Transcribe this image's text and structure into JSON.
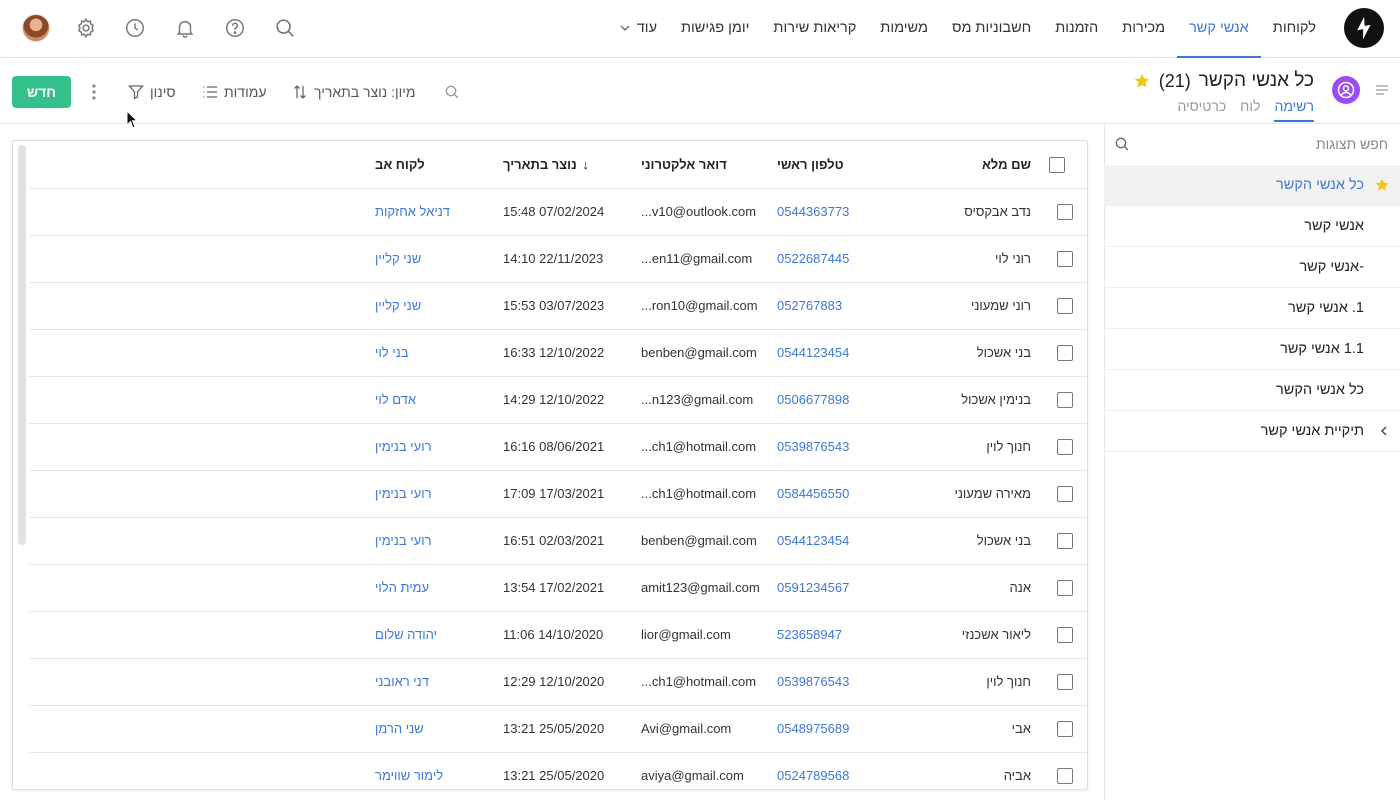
{
  "topnav": {
    "items": [
      {
        "label": "לקוחות",
        "active": false
      },
      {
        "label": "אנשי קשר",
        "active": true
      },
      {
        "label": "מכירות",
        "active": false
      },
      {
        "label": "הזמנות",
        "active": false
      },
      {
        "label": "חשבוניות מס",
        "active": false
      },
      {
        "label": "משימות",
        "active": false
      },
      {
        "label": "קריאות שירות",
        "active": false
      },
      {
        "label": "יומן פגישות",
        "active": false
      },
      {
        "label": "עוד",
        "active": false
      }
    ],
    "icons": [
      "search-icon",
      "help-icon",
      "bell-icon",
      "history-icon",
      "gear-icon",
      "user-avatar"
    ]
  },
  "header": {
    "title": "כל אנשי הקשר",
    "count": "(21)",
    "tabs": [
      {
        "label": "רשימה",
        "active": true
      },
      {
        "label": "לוח",
        "active": false
      },
      {
        "label": "כרטיסיה",
        "active": false
      }
    ]
  },
  "toolbar": {
    "new_label": "חדש",
    "filter_label": "סינון",
    "columns_label": "עמודות",
    "sort_label": "מיון: נוצר בתאריך"
  },
  "sidebar": {
    "search_placeholder": "חפש תצוגות",
    "items": [
      {
        "label": "כל אנשי הקשר",
        "active": true,
        "starred": true
      },
      {
        "label": "אנשי קשר",
        "active": false
      },
      {
        "label": "-אנשי קשר",
        "active": false
      },
      {
        "label": "1. אנשי קשר",
        "active": false
      },
      {
        "label": "1.1 אנשי קשר",
        "active": false
      },
      {
        "label": "כל אנשי הקשר",
        "active": false
      },
      {
        "label": "תיקיית אנשי קשר",
        "active": false,
        "folder": true
      }
    ]
  },
  "table": {
    "columns": {
      "name": "שם מלא",
      "phone": "טלפון ראשי",
      "email": "דואר אלקטרוני",
      "created": "נוצר בתאריך",
      "parent": "לקוח אב"
    },
    "rows": [
      {
        "name": "נדב אבקסיס",
        "phone": "0544363773",
        "email": "v10@outlook.com...",
        "created": "07/02/2024 15:48",
        "parent": "דניאל אחזקות"
      },
      {
        "name": "רוני לוי",
        "phone": "0522687445",
        "email": "en11@gmail.com...",
        "created": "22/11/2023 14:10",
        "parent": "שני קליין"
      },
      {
        "name": "רוני שמעוני",
        "phone": "052767883",
        "email": "ron10@gmail.com...",
        "created": "03/07/2023 15:53",
        "parent": "שני קליין"
      },
      {
        "name": "בני אשכול",
        "phone": "0544123454",
        "email": "benben@gmail.com",
        "created": "12/10/2022 16:33",
        "parent": "בני לוי"
      },
      {
        "name": "בנימין אשכול",
        "phone": "0506677898",
        "email": "n123@gmail.com...",
        "created": "12/10/2022 14:29",
        "parent": "אדם לוי"
      },
      {
        "name": "חנוך לוין",
        "phone": "0539876543",
        "email": "ch1@hotmail.com...",
        "created": "08/06/2021 16:16",
        "parent": "רועי בנימין"
      },
      {
        "name": "מאירה שמעוני",
        "phone": "0584456550",
        "email": "ch1@hotmail.com...",
        "created": "17/03/2021 17:09",
        "parent": "רועי בנימין"
      },
      {
        "name": "בני אשכול",
        "phone": "0544123454",
        "email": "benben@gmail.com",
        "created": "02/03/2021 16:51",
        "parent": "רועי בנימין"
      },
      {
        "name": "אנה",
        "phone": "0591234567",
        "email": "amit123@gmail.com",
        "created": "17/02/2021 13:54",
        "parent": "עמית הלוי"
      },
      {
        "name": "ליאור אשכנזי",
        "phone": "523658947",
        "email": "lior@gmail.com",
        "created": "14/10/2020 11:06",
        "parent": "יהודה שלום"
      },
      {
        "name": "חנוך לוין",
        "phone": "0539876543",
        "email": "ch1@hotmail.com...",
        "created": "12/10/2020 12:29",
        "parent": "דני ראובני"
      },
      {
        "name": "אבי",
        "phone": "0548975689",
        "email": "Avi@gmail.com",
        "created": "25/05/2020 13:21",
        "parent": "שני הרמן"
      },
      {
        "name": "אביה",
        "phone": "0524789568",
        "email": "aviya@gmail.com",
        "created": "25/05/2020 13:21",
        "parent": "לימור שווימר"
      }
    ]
  },
  "colors": {
    "accent": "#3d78d8",
    "new_button": "#35c28a",
    "view_icon": "#9b4cf5",
    "star": "#f5c518"
  }
}
